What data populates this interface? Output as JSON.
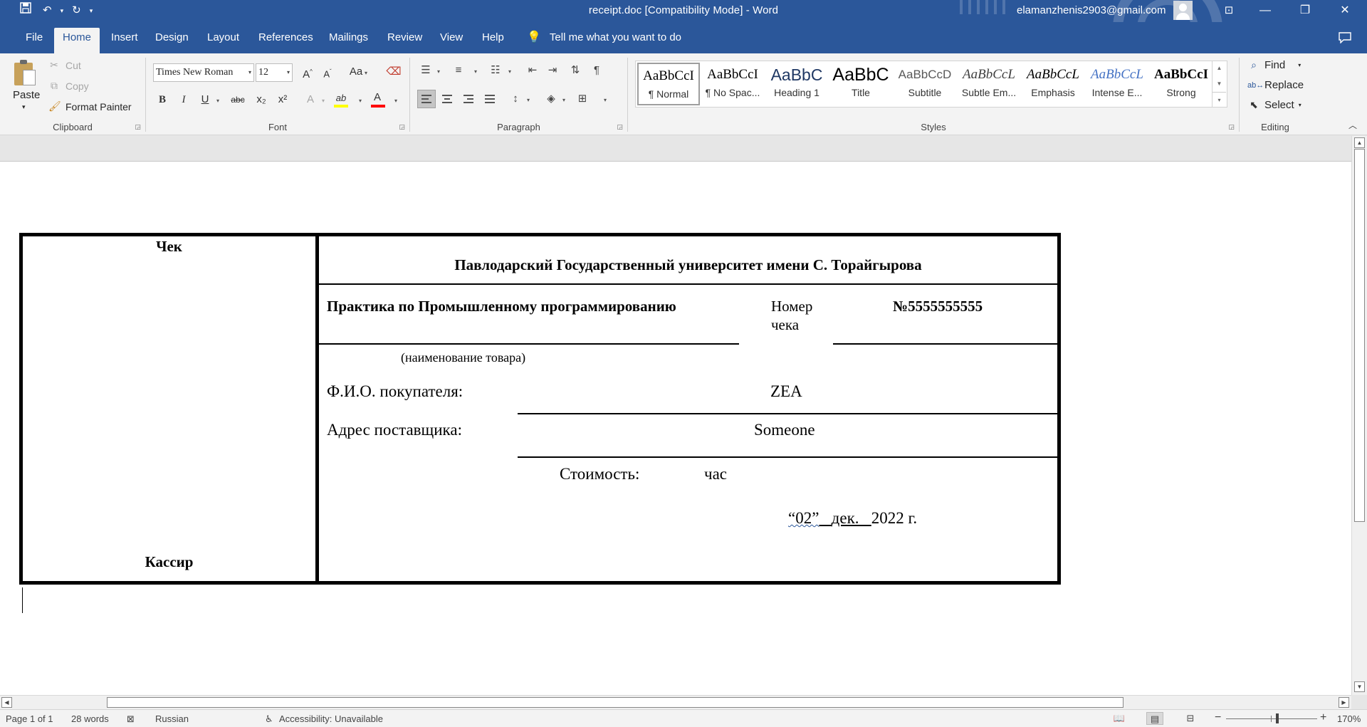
{
  "window": {
    "title": "receipt.doc [Compatibility Mode]  -  Word",
    "account": "elamanzhenis2903@gmail.com",
    "qat": {
      "save_icon": "save-icon",
      "undo_icon": "undo-icon",
      "redo_icon": "redo-icon"
    }
  },
  "menu": {
    "tabs": [
      "File",
      "Home",
      "Insert",
      "Design",
      "Layout",
      "References",
      "Mailings",
      "Review",
      "View",
      "Help"
    ],
    "active_tab": "Home",
    "tell_me": "Tell me what you want to do"
  },
  "ribbon": {
    "clipboard": {
      "label": "Clipboard",
      "paste": "Paste",
      "cut": "Cut",
      "copy": "Copy",
      "format_painter": "Format Painter"
    },
    "font": {
      "label": "Font",
      "font_name": "Times New Roman",
      "font_size": "12",
      "bold": "B",
      "italic": "I",
      "underline": "U",
      "strikethrough": "abc",
      "subscript": "x₂",
      "superscript": "x²",
      "grow": "A",
      "shrink": "A",
      "change_case": "Aa",
      "text_effects": "A",
      "highlight": "ab",
      "font_color": "A",
      "highlight_color": "#ffff00",
      "font_color_value": "#ff0000"
    },
    "paragraph": {
      "label": "Paragraph",
      "show_marks": "¶"
    },
    "styles": {
      "label": "Styles",
      "items": [
        {
          "sample": "AaBbCcI",
          "name": "¶ Normal"
        },
        {
          "sample": "AaBbCcI",
          "name": "¶ No Spac..."
        },
        {
          "sample": "AaBbC",
          "name": "Heading 1"
        },
        {
          "sample": "AaBbC",
          "name": "Title"
        },
        {
          "sample": "AaBbCcD",
          "name": "Subtitle"
        },
        {
          "sample": "AaBbCcL",
          "name": "Subtle Em..."
        },
        {
          "sample": "AaBbCcL",
          "name": "Emphasis"
        },
        {
          "sample": "AaBbCcL",
          "name": "Intense E..."
        },
        {
          "sample": "AaBbCcI",
          "name": "Strong"
        }
      ],
      "selected": "¶ Normal"
    },
    "editing": {
      "label": "Editing",
      "find": "Find",
      "replace": "Replace",
      "select": "Select"
    }
  },
  "document": {
    "left_top": "Чек",
    "left_bottom": "Кассир",
    "university": "Павлодарский Государственный университет имени С. Торайгырова",
    "product": "Практика по Промышленному программированию",
    "product_caption": "(наименование товара)",
    "check_label_1": "Номер",
    "check_label_2": "чека",
    "check_number": "№5555555555",
    "buyer_label": "Ф.И.О. покупателя:",
    "buyer_value": "ZEA",
    "supplier_label": "Адрес поставщика:",
    "supplier_value": "Someone",
    "cost_label": "Стоимость:",
    "cost_unit": "час",
    "date_day": "“02”",
    "date_month": "дек.",
    "date_year": "2022  г."
  },
  "statusbar": {
    "page": "Page 1 of 1",
    "words": "28 words",
    "language": "Russian",
    "accessibility": "Accessibility: Unavailable",
    "zoom": "170%"
  }
}
